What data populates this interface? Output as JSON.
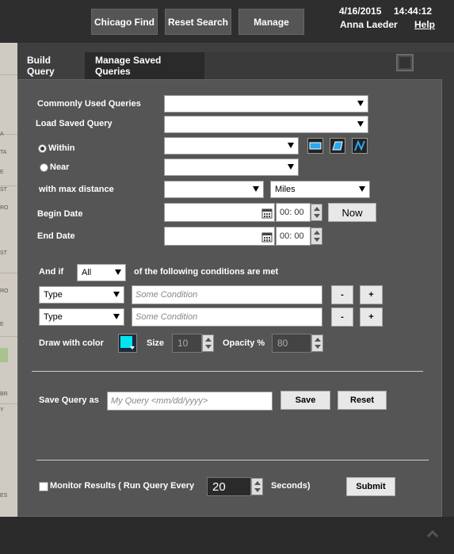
{
  "topbar": {
    "chicago_find": "Chicago Find",
    "reset_search": "Reset Search",
    "manage": "Manage",
    "date": "4/16/2015",
    "time": "14:44:12",
    "user": "Anna Laeder",
    "help": "Help"
  },
  "tabs": [
    {
      "label": "Build Query"
    },
    {
      "label": "Manage Saved Queries"
    }
  ],
  "form": {
    "commonly_used_label": "Commonly Used Queries",
    "commonly_used_value": "",
    "load_saved_label": "Load Saved Query",
    "load_saved_value": "",
    "within_label": "Within",
    "within_value": "",
    "near_label": "Near",
    "near_value": "",
    "max_distance_label": "with max distance",
    "max_distance_value": "",
    "distance_unit": "Miles",
    "begin_date_label": "Begin Date",
    "begin_time": "00: 00",
    "now_button": "Now",
    "end_date_label": "End Date",
    "end_time": "00: 00",
    "and_if_label": "And if",
    "and_if_value": "All",
    "conditions_suffix": "of the following conditions are met",
    "conditions": [
      {
        "type": "Type",
        "placeholder": "Some Condition",
        "minus": "-",
        "plus": "+"
      },
      {
        "type": "Type",
        "placeholder": "Some Condition",
        "minus": "-",
        "plus": "+"
      }
    ],
    "draw_color_label": "Draw with color",
    "draw_color": "#00e5f0",
    "size_label": "Size",
    "size_value": "10",
    "opacity_label": "Opacity %",
    "opacity_value": "80",
    "save_query_label": "Save Query as",
    "save_query_placeholder": "My Query <mm/dd/yyyy>",
    "save_button": "Save",
    "reset_button": "Reset",
    "monitor_label": "Monitor Results ( Run Query Every",
    "monitor_value": "20",
    "seconds_label": "Seconds)",
    "submit_button": "Submit"
  },
  "map_labels": [
    "A",
    "TA",
    "E",
    "ST",
    "RO",
    "ST",
    "RO",
    "E",
    "BR",
    "Y",
    "ES"
  ]
}
